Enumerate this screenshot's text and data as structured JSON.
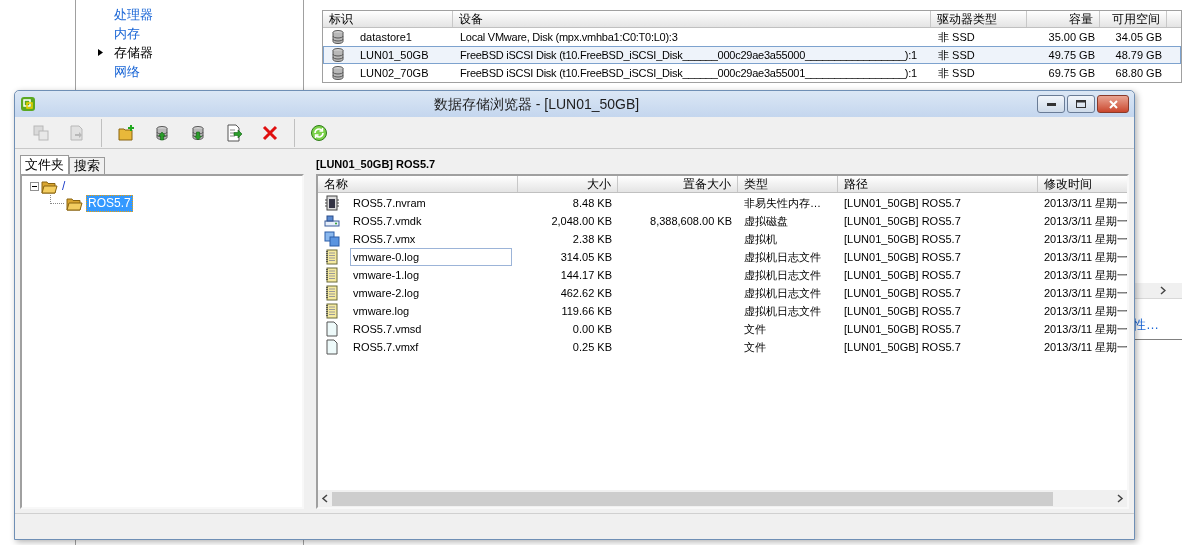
{
  "background": {
    "nav": [
      {
        "label": "处理器",
        "selected": false
      },
      {
        "label": "内存",
        "selected": false
      },
      {
        "label": "存储器",
        "selected": true
      },
      {
        "label": "网络",
        "selected": false
      }
    ],
    "datastores": {
      "columns": [
        "标识",
        "设备",
        "驱动器类型",
        "容量",
        "可用空间"
      ],
      "rows": [
        {
          "cells": [
            "datastore1",
            "Local VMware, Disk (mpx.vmhba1:C0:T0:L0):3",
            "非 SSD",
            "35.00 GB",
            "34.05 GB"
          ],
          "selected": false
        },
        {
          "cells": [
            "LUN01_50GB",
            "FreeBSD iSCSI Disk (t10.FreeBSD_iSCSI_Disk______000c29ae3a55000_________________):1",
            "非 SSD",
            "49.75 GB",
            "48.79 GB"
          ],
          "selected": true
        },
        {
          "cells": [
            "LUN02_70GB",
            "FreeBSD iSCSI Disk (t10.FreeBSD_iSCSI_Disk______000c29ae3a55001_________________):1",
            "非 SSD",
            "69.75 GB",
            "68.80 GB"
          ],
          "selected": false
        }
      ]
    },
    "side_link": "性…"
  },
  "window": {
    "title": "数据存储浏览器 - [LUN01_50GB]",
    "toolbar": [
      [
        {
          "kind": "copy",
          "disabled": true
        },
        {
          "kind": "move",
          "disabled": true
        }
      ],
      [
        {
          "kind": "new-folder",
          "disabled": false
        },
        {
          "kind": "upload",
          "disabled": false
        },
        {
          "kind": "download",
          "disabled": false
        },
        {
          "kind": "register",
          "disabled": false
        },
        {
          "kind": "delete",
          "disabled": false
        }
      ],
      [
        {
          "kind": "refresh",
          "disabled": false
        }
      ]
    ],
    "tabs": [
      {
        "label": "文件夹",
        "selected": true
      },
      {
        "label": "搜索",
        "selected": false
      }
    ],
    "tree": [
      {
        "label": "/",
        "expanded": true,
        "selected": false,
        "children": [
          {
            "label": "ROS5.7",
            "selected": true
          }
        ]
      }
    ],
    "path": "[LUN01_50GB] ROS5.7",
    "files": {
      "columns": [
        "名称",
        "大小",
        "置备大小",
        "类型",
        "路径",
        "修改时间"
      ],
      "rows": [
        {
          "kind": "nvram",
          "focused": false,
          "cells": [
            "ROS5.7.nvram",
            "8.48 KB",
            "",
            "非易失性内存…",
            "[LUN01_50GB] ROS5.7",
            "2013/3/11 星期一"
          ]
        },
        {
          "kind": "disk",
          "focused": false,
          "cells": [
            "ROS5.7.vmdk",
            "2,048.00 KB",
            "8,388,608.00 KB",
            "虚拟磁盘",
            "[LUN01_50GB] ROS5.7",
            "2013/3/11 星期一"
          ]
        },
        {
          "kind": "vm",
          "focused": false,
          "cells": [
            "ROS5.7.vmx",
            "2.38 KB",
            "",
            "虚拟机",
            "[LUN01_50GB] ROS5.7",
            "2013/3/11 星期一"
          ]
        },
        {
          "kind": "log",
          "focused": true,
          "cells": [
            "vmware-0.log",
            "314.05 KB",
            "",
            "虚拟机日志文件",
            "[LUN01_50GB] ROS5.7",
            "2013/3/11 星期一"
          ]
        },
        {
          "kind": "log",
          "focused": false,
          "cells": [
            "vmware-1.log",
            "144.17 KB",
            "",
            "虚拟机日志文件",
            "[LUN01_50GB] ROS5.7",
            "2013/3/11 星期一"
          ]
        },
        {
          "kind": "log",
          "focused": false,
          "cells": [
            "vmware-2.log",
            "462.62 KB",
            "",
            "虚拟机日志文件",
            "[LUN01_50GB] ROS5.7",
            "2013/3/11 星期一"
          ]
        },
        {
          "kind": "log",
          "focused": false,
          "cells": [
            "vmware.log",
            "119.66 KB",
            "",
            "虚拟机日志文件",
            "[LUN01_50GB] ROS5.7",
            "2013/3/11 星期一"
          ]
        },
        {
          "kind": "file",
          "focused": false,
          "cells": [
            "ROS5.7.vmsd",
            "0.00 KB",
            "",
            "文件",
            "[LUN01_50GB] ROS5.7",
            "2013/3/11 星期一"
          ]
        },
        {
          "kind": "file",
          "focused": false,
          "cells": [
            "ROS5.7.vmxf",
            "0.25 KB",
            "",
            "文件",
            "[LUN01_50GB] ROS5.7",
            "2013/3/11 星期一"
          ]
        }
      ]
    }
  }
}
